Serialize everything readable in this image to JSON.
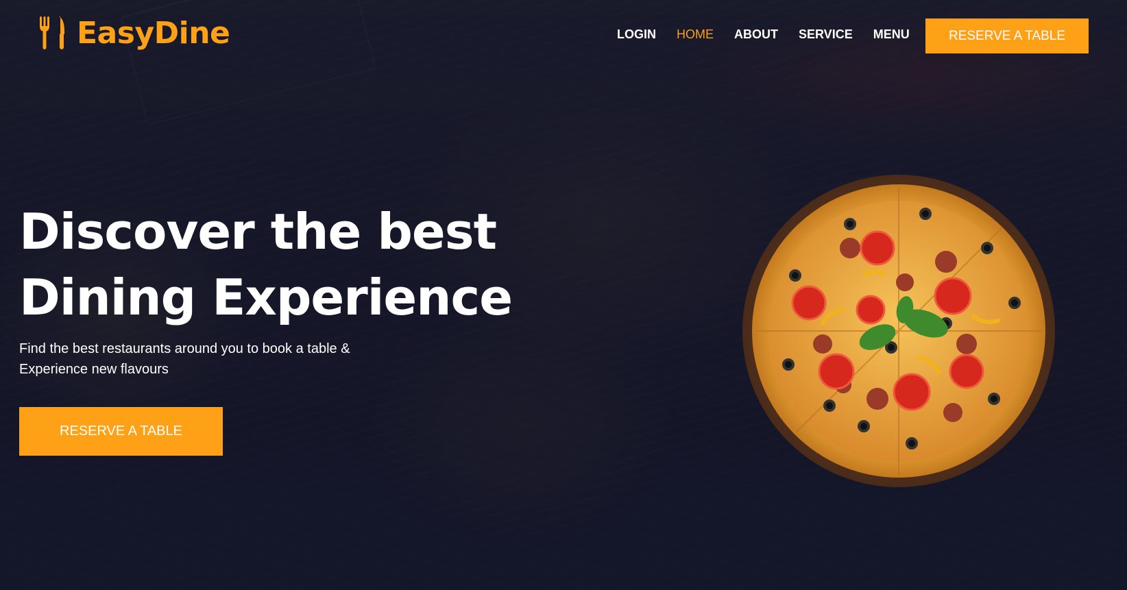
{
  "brand": {
    "name": "EasyDine",
    "icon": "utensils-icon",
    "accent_color": "#FEA116"
  },
  "nav": {
    "links": [
      {
        "label": "LOGIN",
        "active": false
      },
      {
        "label": "HOME",
        "active": true
      },
      {
        "label": "ABOUT",
        "active": false
      },
      {
        "label": "SERVICE",
        "active": false
      },
      {
        "label": "MENU",
        "active": false
      }
    ],
    "cta_label": "RESERVE A TABLE"
  },
  "hero": {
    "title_line1": "Discover the best",
    "title_line2": "Dining Experience",
    "subtitle_line1": "Find the best restaurants around you to book a table &",
    "subtitle_line2": "Experience new flavours",
    "cta_label": "RESERVE A TABLE",
    "image": "pizza-image",
    "overlay_color": "#161827"
  }
}
